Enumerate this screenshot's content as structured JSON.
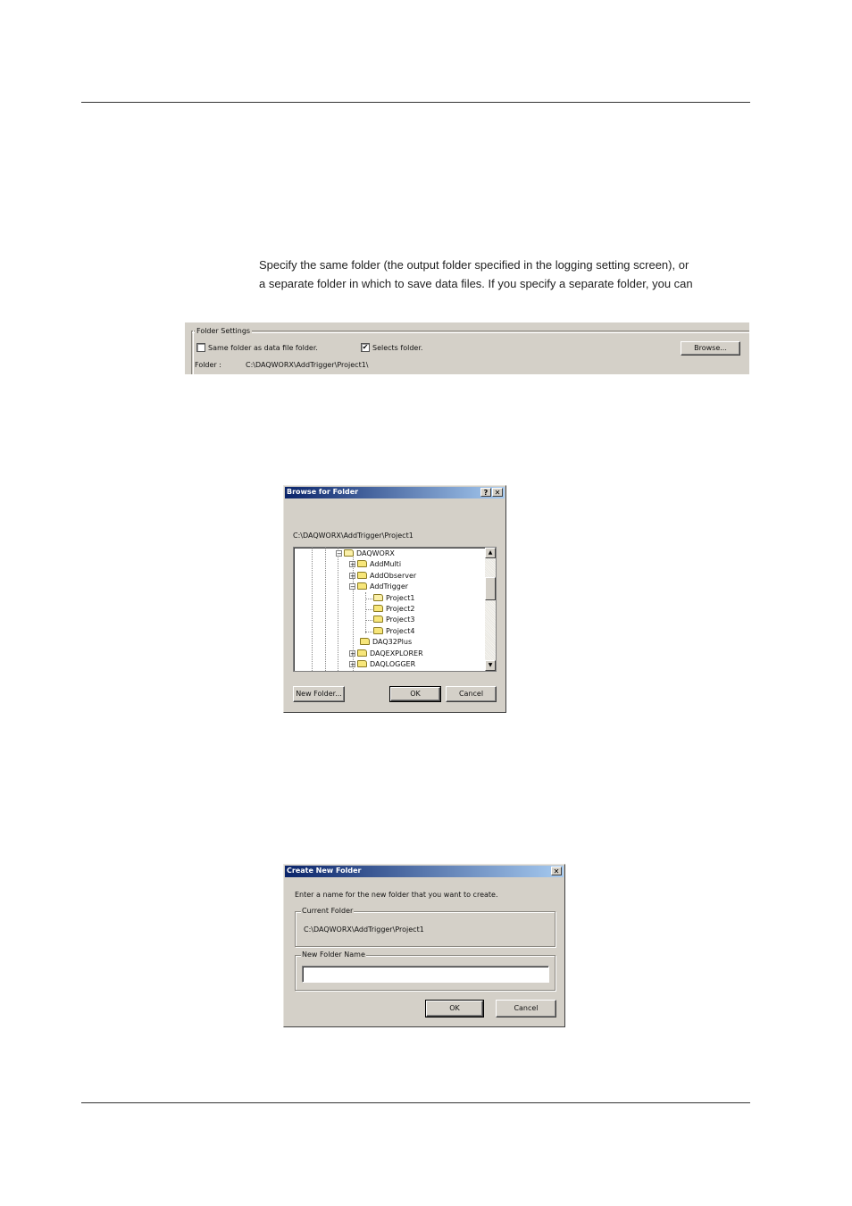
{
  "document": {
    "paragraph_lines": [
      "Specify the same folder (the output folder specified in the logging setting screen), or",
      "a separate folder in which to save data files. If you specify a separate folder, you can"
    ]
  },
  "folder_settings": {
    "legend": "Folder Settings",
    "same_folder_label": "Same folder as data file folder.",
    "same_folder_checked": false,
    "selects_folder_label": "Selects folder.",
    "selects_folder_checked": true,
    "browse_button": "Browse...",
    "folder_label": "Folder :",
    "folder_value": "C:\\DAQWORX\\AddTrigger\\Project1\\"
  },
  "browse_dialog": {
    "title": "Browse for Folder",
    "help_button": "?",
    "close_button": "✕",
    "current_path": "C:\\DAQWORX\\AddTrigger\\Project1",
    "tree": [
      {
        "label": "DAQWORX",
        "expander": "−",
        "open": true
      },
      {
        "label": "AddMulti",
        "expander": "+"
      },
      {
        "label": "AddObserver",
        "expander": "+"
      },
      {
        "label": "AddTrigger",
        "expander": "−"
      },
      {
        "label": "Project1",
        "open": true,
        "selected": true
      },
      {
        "label": "Project2"
      },
      {
        "label": "Project3"
      },
      {
        "label": "Project4"
      },
      {
        "label": "DAQ32Plus"
      },
      {
        "label": "DAQEXPLORER",
        "expander": "+"
      },
      {
        "label": "DAQLOGGER",
        "expander": "+"
      }
    ],
    "new_folder_button": "New Folder...",
    "ok_button": "OK",
    "cancel_button": "Cancel"
  },
  "create_dialog": {
    "title": "Create New Folder",
    "close_button": "✕",
    "instruction": "Enter a name for the new folder that you want to create.",
    "current_folder_legend": "Current Folder",
    "current_folder_value": "C:\\DAQWORX\\AddTrigger\\Project1",
    "new_folder_legend": "New Folder Name",
    "new_folder_value": "",
    "ok_button": "OK",
    "cancel_button": "Cancel"
  }
}
